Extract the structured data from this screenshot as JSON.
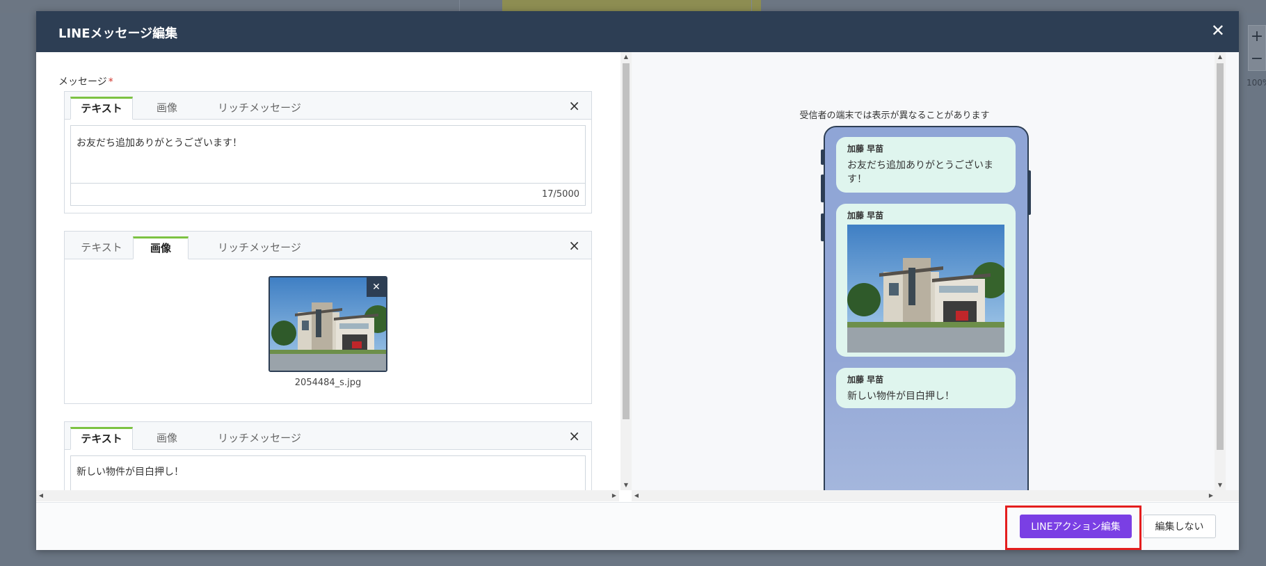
{
  "background": {
    "zoom_plus": "+",
    "zoom_minus": "−",
    "zoom_label": "100%"
  },
  "modal": {
    "title": "LINEメッセージ編集",
    "close_glyph": "✕"
  },
  "editor": {
    "field_label": "メッセージ",
    "required_mark": "*",
    "tabs": [
      "テキスト",
      "画像",
      "リッチメッセージ"
    ],
    "remove_glyph": "×",
    "cards": [
      {
        "type": "text",
        "active_tab": "テキスト",
        "text": "お友だち追加ありがとうございます！",
        "char_count": "17/5000"
      },
      {
        "type": "image",
        "active_tab": "画像",
        "file_name": "2054484_s.jpg",
        "thumb_close": "✕"
      },
      {
        "type": "text",
        "active_tab": "テキスト",
        "text": "新しい物件が目白押し！"
      }
    ]
  },
  "preview": {
    "note": "受信者の端末では表示が異なることがあります",
    "messages": [
      {
        "sender": "加藤 早苗",
        "text": "お友だち追加ありがとうございます！"
      },
      {
        "sender": "加藤 早苗",
        "image": "house-photo"
      },
      {
        "sender": "加藤 早苗",
        "text": "新しい物件が目白押し！"
      }
    ]
  },
  "footer": {
    "primary_label": "LINEアクション編集",
    "secondary_label": "編集しない"
  },
  "colors": {
    "header_bg": "#2d3e54",
    "active_tab_accent": "#7cc242",
    "primary_button": "#7a3fe4",
    "highlight": "#e41e1e",
    "bubble": "#dff5ee"
  }
}
